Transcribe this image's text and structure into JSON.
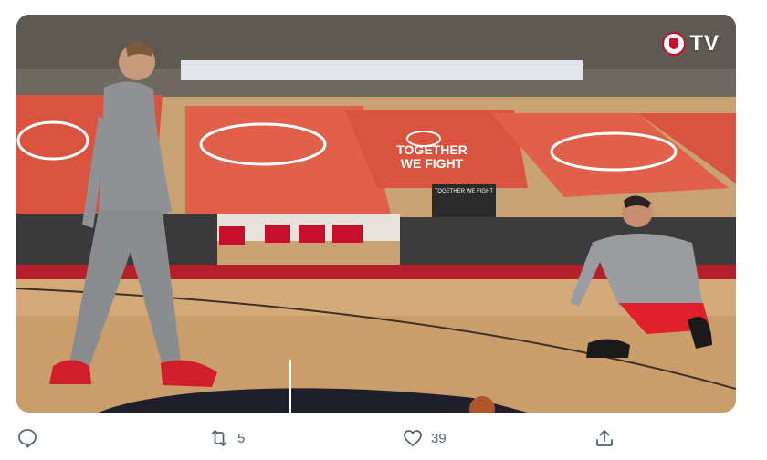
{
  "overlay": {
    "brand_text": "TV"
  },
  "arena": {
    "banner_top": "TOGETHER",
    "banner_bottom": "WE FIGHT",
    "small_sign": "TOGETHER WE FIGHT"
  },
  "actions": {
    "reply_count": "",
    "retweet_count": "5",
    "like_count": "39"
  },
  "colors": {
    "brand_red": "#c8102e",
    "icon_gray": "#536471"
  },
  "icons": [
    "reply-icon",
    "retweet-icon",
    "like-icon",
    "share-icon"
  ]
}
